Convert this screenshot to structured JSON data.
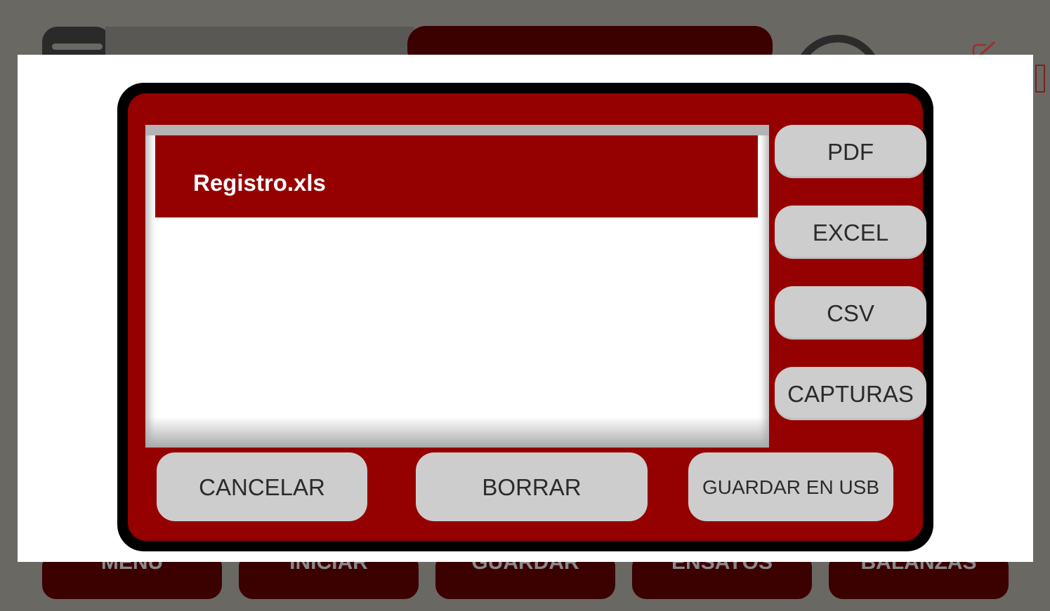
{
  "background": {
    "bottom_nav": [
      "MENU",
      "INICIAR",
      "GUARDAR",
      "ENSAYOS",
      "BALANZAS"
    ]
  },
  "dialog": {
    "files": [
      {
        "name": "Registro.xls",
        "selected": true
      }
    ],
    "format_buttons": {
      "pdf": "PDF",
      "excel": "EXCEL",
      "csv": "CSV",
      "capturas": "CAPTURAS"
    },
    "actions": {
      "cancel": "CANCELAR",
      "delete": "BORRAR",
      "save_usb": "GUARDAR EN USB"
    }
  },
  "colors": {
    "dialog_red": "#950000",
    "button_grey": "#cdcdcd",
    "dim_background": "#6a6863",
    "dark_red_dimmed": "#3b0000"
  },
  "icons": [
    "menu-icon",
    "wifi-icon",
    "edit-icon"
  ]
}
